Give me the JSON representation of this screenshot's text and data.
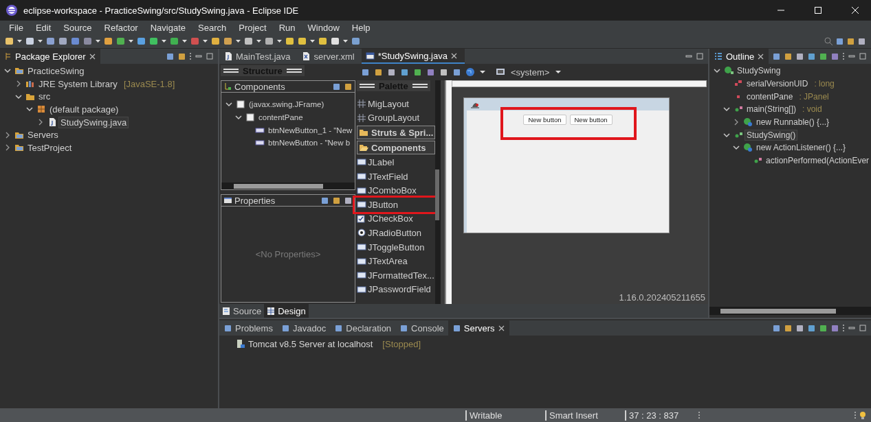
{
  "window": {
    "title": "eclipse-workspace - PracticeSwing/src/StudySwing.java - Eclipse IDE"
  },
  "menu": [
    "File",
    "Edit",
    "Source",
    "Refactor",
    "Navigate",
    "Search",
    "Project",
    "Run",
    "Window",
    "Help"
  ],
  "package_explorer": {
    "title": "Package Explorer",
    "tree": [
      {
        "label": "PracticeSwing",
        "kind": "project",
        "expanded": true,
        "selected": false,
        "children": [
          {
            "label": "JRE System Library",
            "detail": "[JavaSE-1.8]",
            "kind": "library",
            "expanded": false,
            "selected": false
          },
          {
            "label": "src",
            "kind": "folder",
            "expanded": true,
            "selected": false,
            "children": [
              {
                "label": "(default package)",
                "kind": "package",
                "expanded": true,
                "selected": false,
                "children": [
                  {
                    "label": "StudySwing.java",
                    "kind": "java",
                    "expanded": false,
                    "selected": true
                  }
                ]
              }
            ]
          }
        ]
      },
      {
        "label": "Servers",
        "kind": "project",
        "expanded": false,
        "selected": false
      },
      {
        "label": "TestProject",
        "kind": "project",
        "expanded": false,
        "selected": false
      }
    ]
  },
  "editor_tabs": [
    {
      "label": "MainTest.java",
      "kind": "java",
      "selected": false
    },
    {
      "label": "server.xml",
      "kind": "xml",
      "selected": false
    },
    {
      "label": "*StudySwing.java",
      "kind": "design",
      "selected": true
    }
  ],
  "structure": {
    "title": "Structure",
    "components": {
      "title": "Components",
      "tree": [
        {
          "label": "(javax.swing.JFrame)",
          "kind": "frame",
          "expanded": true,
          "children": [
            {
              "label": "contentPane",
              "kind": "panel",
              "expanded": true,
              "children": [
                {
                  "label": "btnNewButton_1 - \"New",
                  "kind": "button"
                },
                {
                  "label": "btnNewButton - \"New b",
                  "kind": "button"
                }
              ]
            }
          ]
        }
      ]
    },
    "properties": {
      "title": "Properties",
      "empty_text": "<No Properties>"
    }
  },
  "palette": {
    "title": "Palette",
    "items": [
      {
        "label": "MigLayout",
        "kind": "layout",
        "highlighted": false
      },
      {
        "label": "GroupLayout",
        "kind": "layout",
        "highlighted": false
      },
      {
        "label": "Struts & Spri...",
        "kind": "category",
        "expanded": false,
        "highlighted": false
      },
      {
        "label": "Components",
        "kind": "category",
        "expanded": true,
        "highlighted": false
      },
      {
        "label": "JLabel",
        "kind": "component",
        "highlighted": false
      },
      {
        "label": "JTextField",
        "kind": "component",
        "highlighted": false
      },
      {
        "label": "JComboBox",
        "kind": "component",
        "highlighted": false
      },
      {
        "label": "JButton",
        "kind": "component",
        "highlighted": true
      },
      {
        "label": "JCheckBox",
        "kind": "checkbox",
        "highlighted": false
      },
      {
        "label": "JRadioButton",
        "kind": "radio",
        "highlighted": false
      },
      {
        "label": "JToggleButton",
        "kind": "component",
        "highlighted": false
      },
      {
        "label": "JTextArea",
        "kind": "component",
        "highlighted": false
      },
      {
        "label": "JFormattedTex...",
        "kind": "component",
        "highlighted": false
      },
      {
        "label": "JPasswordField",
        "kind": "component",
        "highlighted": false
      }
    ]
  },
  "designer": {
    "system_label": "<system>",
    "buttons": [
      "New button",
      "New button"
    ],
    "highlighted": true,
    "version": "1.16.0.202405211655"
  },
  "view_tabs": [
    {
      "label": "Source",
      "selected": false
    },
    {
      "label": "Design",
      "selected": true
    }
  ],
  "outline": {
    "title": "Outline",
    "tree": [
      {
        "label": "StudySwing",
        "kind": "class",
        "expanded": true,
        "selected": false,
        "children": [
          {
            "label": "serialVersionUID",
            "detail": ": long",
            "kind": "constant",
            "selected": false
          },
          {
            "label": "contentPane",
            "detail": ": JPanel",
            "kind": "field",
            "selected": false
          },
          {
            "label": "main(String[])",
            "detail": ": void",
            "kind": "method",
            "expanded": true,
            "selected": false,
            "children": [
              {
                "label": "new Runnable() {...}",
                "kind": "anonymous",
                "expanded": false,
                "selected": false
              }
            ]
          },
          {
            "label": "StudySwing()",
            "kind": "constructor",
            "expanded": true,
            "selected": true,
            "children": [
              {
                "label": "new ActionListener() {...}",
                "kind": "anonymous",
                "expanded": true,
                "selected": false,
                "children": [
                  {
                    "label": "actionPerformed(ActionEver",
                    "kind": "method",
                    "selected": false
                  }
                ]
              }
            ]
          }
        ]
      }
    ]
  },
  "bottom_panel": {
    "tabs": [
      {
        "label": "Problems",
        "selected": false
      },
      {
        "label": "Javadoc",
        "selected": false
      },
      {
        "label": "Declaration",
        "selected": false
      },
      {
        "label": "Console",
        "selected": false
      },
      {
        "label": "Servers",
        "selected": true
      }
    ],
    "rows": [
      {
        "label": "Tomcat v8.5 Server at localhost",
        "status": "[Stopped]"
      }
    ]
  },
  "status_bar": [
    "Writable",
    "Smart Insert",
    "37 : 23 : 837"
  ]
}
